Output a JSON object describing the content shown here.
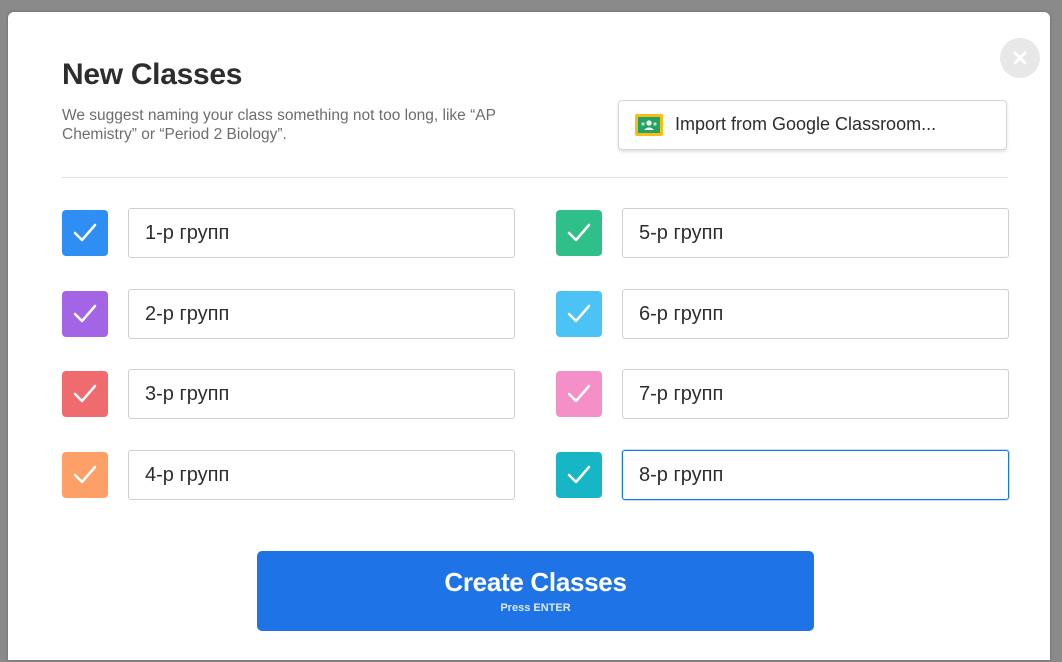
{
  "dialog": {
    "title": "New Classes",
    "subtitle": "We suggest naming your class something not too long, like “AP Chemistry” or “Period 2 Biology”.",
    "close_icon": "close-icon",
    "import_button": {
      "label": "Import from Google Classroom...",
      "icon": "google-classroom-icon"
    }
  },
  "classes": [
    {
      "value": "1-р групп",
      "checked": true,
      "color": "#2f8ef4"
    },
    {
      "value": "2-р групп",
      "checked": true,
      "color": "#a464e6"
    },
    {
      "value": "3-р групп",
      "checked": true,
      "color": "#f06b6d"
    },
    {
      "value": "4-р групп",
      "checked": true,
      "color": "#fca067"
    },
    {
      "value": "5-р групп",
      "checked": true,
      "color": "#2fc08a"
    },
    {
      "value": "6-р групп",
      "checked": true,
      "color": "#4bc3f5"
    },
    {
      "value": "7-р групп",
      "checked": true,
      "color": "#f58fc7"
    },
    {
      "value": "8-р групп",
      "checked": true,
      "color": "#17b6c6",
      "focused": true
    }
  ],
  "create_button": {
    "label": "Create Classes",
    "hint": "Press ENTER",
    "color": "#1e74e6"
  }
}
